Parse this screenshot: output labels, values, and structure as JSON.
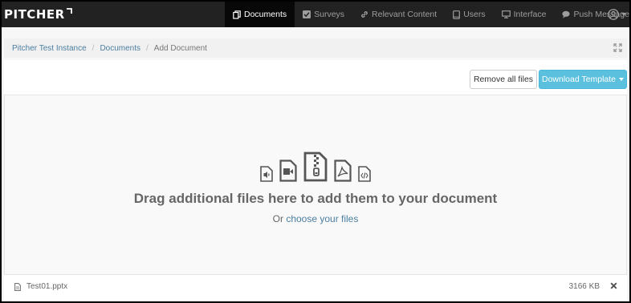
{
  "brand": {
    "name": "PITCHER"
  },
  "nav": {
    "items": [
      {
        "label": "Documents",
        "icon": "documents-icon",
        "active": true
      },
      {
        "label": "Surveys",
        "icon": "checkbox-icon",
        "active": false
      },
      {
        "label": "Relevant Content",
        "icon": "link-icon",
        "active": false
      },
      {
        "label": "Users",
        "icon": "tablet-icon",
        "active": false
      },
      {
        "label": "Interface",
        "icon": "monitor-icon",
        "active": false
      },
      {
        "label": "Push Messages",
        "icon": "chat-icon",
        "active": false
      }
    ],
    "user_icon": "user-circle-icon"
  },
  "breadcrumb": {
    "items": [
      "Pitcher Test Instance",
      "Documents"
    ],
    "current": "Add Document",
    "separator": "/"
  },
  "toolbar": {
    "remove_all_label": "Remove all files",
    "download_template_label": "Download Template"
  },
  "dropzone": {
    "title": "Drag additional files here to add them to your document",
    "subtitle_prefix": "Or",
    "subtitle_link": "choose your files",
    "file_type_icons": [
      "audio-file-icon",
      "video-file-icon",
      "zip-file-icon",
      "pdf-file-icon",
      "code-file-icon"
    ]
  },
  "files": [
    {
      "name": "Test01.pptx",
      "size": "3166 KB"
    }
  ],
  "colors": {
    "navbar": "#222222",
    "accent_button": "#5bc0de",
    "link": "#4a7ea0"
  }
}
